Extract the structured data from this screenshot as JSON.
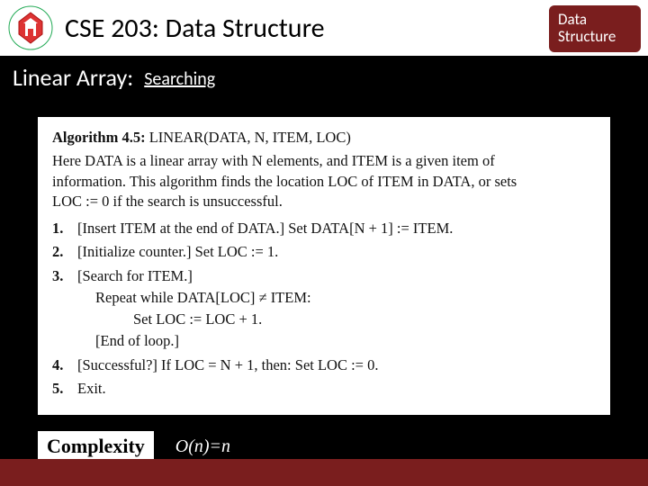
{
  "header": {
    "course_title": "CSE 203: Data Structure",
    "badge_line1": "Data",
    "badge_line2": "Structure"
  },
  "subtitle": {
    "label": "Linear Array:",
    "topic": "Searching"
  },
  "algorithm": {
    "title_prefix": "Algorithm 4.5:",
    "title_rest": " LINEAR(DATA, N, ITEM, LOC)",
    "desc1": "Here DATA is a linear array with N elements, and ITEM is a given item of",
    "desc2": "information. This algorithm finds the location LOC of ITEM in DATA, or sets",
    "desc3": "LOC := 0 if the search is unsuccessful.",
    "steps": [
      {
        "n": "1.",
        "t": "[Insert ITEM at the end of DATA.] Set DATA[N + 1] := ITEM."
      },
      {
        "n": "2.",
        "t": "[Initialize counter.] Set LOC := 1."
      },
      {
        "n": "3.",
        "t": "[Search for ITEM.]"
      },
      {
        "n": "4.",
        "t": "[Successful?] If LOC = N + 1, then: Set LOC := 0."
      },
      {
        "n": "5.",
        "t": "Exit."
      }
    ],
    "step3_sub1": "Repeat while DATA[LOC] ≠ ITEM:",
    "step3_sub2": "Set LOC := LOC + 1.",
    "step3_sub3": "[End of loop.]"
  },
  "complexity": {
    "label": "Complexity",
    "value": "O(n)=n"
  }
}
